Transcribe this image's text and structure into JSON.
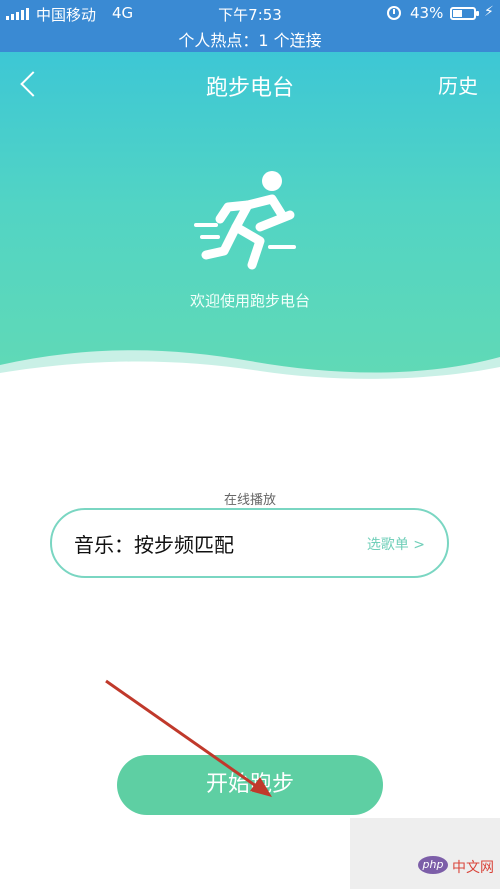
{
  "status_bar": {
    "carrier": "中国移动",
    "network": "4G",
    "time": "下午7:53",
    "battery": "43%",
    "hotspot": "个人热点：1 个连接"
  },
  "header": {
    "title": "跑步电台",
    "history": "历史",
    "welcome": "欢迎使用跑步电台"
  },
  "card": {
    "legend": "在线播放",
    "title": "音乐：按步频匹配",
    "playlist_link": "选歌单 >"
  },
  "start_button": "开始跑步",
  "watermark": {
    "logo": "php",
    "text": "中文网"
  },
  "colors": {
    "status_bar": "#3a8ad3",
    "gradient_top": "#3dc7d5",
    "gradient_bottom": "#62dab4",
    "accent": "#5ecfa3",
    "card_border": "#7ad6c2",
    "arrow": "#c0392b"
  },
  "icons": [
    "back-chevron-icon",
    "runner-icon",
    "alarm-icon",
    "battery-icon",
    "charging-icon",
    "signal-icon",
    "annotation-arrow"
  ]
}
